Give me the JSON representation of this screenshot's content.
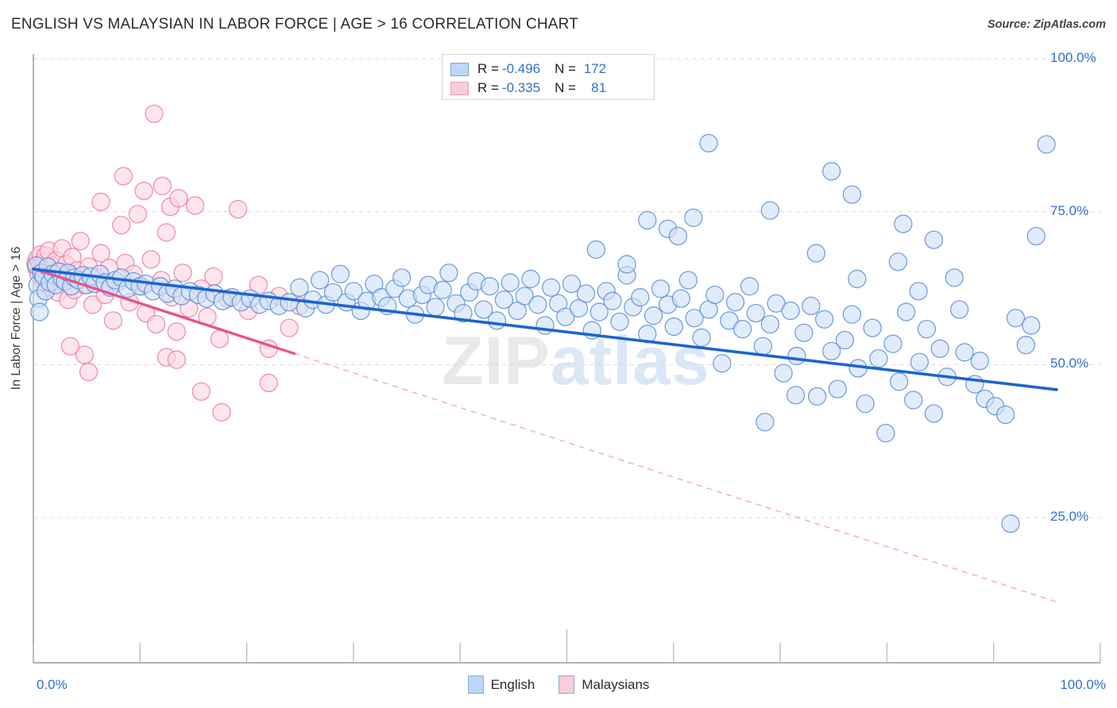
{
  "header": {
    "title": "ENGLISH VS MALAYSIAN IN LABOR FORCE | AGE > 16 CORRELATION CHART",
    "source": "Source: ZipAtlas.com"
  },
  "watermark": {
    "part1": "ZIP",
    "part2": "atlas"
  },
  "stats": {
    "rows": [
      {
        "series": "English",
        "r_label": "R = ",
        "r_value": "-0.496",
        "n_label": "N = ",
        "n_value": "172",
        "color": "#bdd7f7"
      },
      {
        "series": "Malaysians",
        "r_label": "R = ",
        "r_value": "-0.335",
        "n_label": "N = ",
        "n_value": "81",
        "color": "#fbccdb"
      }
    ]
  },
  "legend": {
    "items": [
      {
        "label": "English",
        "color": "#bdd7f7"
      },
      {
        "label": "Malaysians",
        "color": "#fbccdb"
      }
    ]
  },
  "axes": {
    "y_label": "In Labor Force | Age > 16",
    "y_ticks": [
      "100.0%",
      "75.0%",
      "50.0%",
      "25.0%"
    ],
    "x_ticks": [
      "0.0%",
      "100.0%"
    ]
  },
  "chart_data": {
    "type": "scatter",
    "title": "ENGLISH VS MALAYSIAN IN LABOR FORCE | AGE > 16 CORRELATION CHART",
    "xlabel": "",
    "ylabel": "In Labor Force | Age > 16",
    "xlim": [
      0,
      100
    ],
    "ylim": [
      0,
      103
    ],
    "x_tick_values": [
      0,
      100
    ],
    "y_tick_values": [
      25,
      50,
      75,
      100
    ],
    "grid": "horizontal-dashed",
    "legend_position": "bottom-center",
    "colors": {
      "english_fill": "#cfe0f7",
      "english_stroke": "#5a8fd6",
      "english_line": "#1c64d1",
      "malaysian_fill": "#fbd5e0",
      "malaysian_stroke": "#ee7ba5",
      "malaysian_line": "#e8538a",
      "tick_text": "#2f6fd0",
      "title_text": "#2b2b2b"
    },
    "series": [
      {
        "name": "English",
        "r": -0.496,
        "n": 172,
        "trend": {
          "x0": 0,
          "y0": 65.6,
          "x1": 100,
          "y1": 45.9,
          "style": "solid"
        },
        "points": [
          [
            0.3,
            66.2
          ],
          [
            0.4,
            63.0
          ],
          [
            0.5,
            60.8
          ],
          [
            0.6,
            58.6
          ],
          [
            0.8,
            65.0
          ],
          [
            1.0,
            64.4
          ],
          [
            1.2,
            62.0
          ],
          [
            1.4,
            66.0
          ],
          [
            1.6,
            63.4
          ],
          [
            1.9,
            64.8
          ],
          [
            2.2,
            63.0
          ],
          [
            2.5,
            65.2
          ],
          [
            2.8,
            64.0
          ],
          [
            3.1,
            63.6
          ],
          [
            3.4,
            65.0
          ],
          [
            3.7,
            62.8
          ],
          [
            4.0,
            64.2
          ],
          [
            4.4,
            63.8
          ],
          [
            4.8,
            64.6
          ],
          [
            5.2,
            63.0
          ],
          [
            5.6,
            64.4
          ],
          [
            6.0,
            63.2
          ],
          [
            6.5,
            64.8
          ],
          [
            7.0,
            63.4
          ],
          [
            7.5,
            62.6
          ],
          [
            8.0,
            63.8
          ],
          [
            8.6,
            64.2
          ],
          [
            9.2,
            62.4
          ],
          [
            9.8,
            63.6
          ],
          [
            10.4,
            62.8
          ],
          [
            11.0,
            63.2
          ],
          [
            11.7,
            62.0
          ],
          [
            12.4,
            62.8
          ],
          [
            13.1,
            61.6
          ],
          [
            13.8,
            62.4
          ],
          [
            14.5,
            61.2
          ],
          [
            15.3,
            62.0
          ],
          [
            16.1,
            61.4
          ],
          [
            16.9,
            60.8
          ],
          [
            17.7,
            61.6
          ],
          [
            18.5,
            60.4
          ],
          [
            19.4,
            61.0
          ],
          [
            20.3,
            60.2
          ],
          [
            21.2,
            60.8
          ],
          [
            22.1,
            59.8
          ],
          [
            23.0,
            60.4
          ],
          [
            24.0,
            59.6
          ],
          [
            25.0,
            60.2
          ],
          [
            26.0,
            62.6
          ],
          [
            26.6,
            59.2
          ],
          [
            27.3,
            60.6
          ],
          [
            28.0,
            63.8
          ],
          [
            28.6,
            59.8
          ],
          [
            29.3,
            61.8
          ],
          [
            30.0,
            64.8
          ],
          [
            30.6,
            60.2
          ],
          [
            31.3,
            62.0
          ],
          [
            32.0,
            58.8
          ],
          [
            32.6,
            60.4
          ],
          [
            33.3,
            63.2
          ],
          [
            34.0,
            61.0
          ],
          [
            34.6,
            59.6
          ],
          [
            35.3,
            62.4
          ],
          [
            36.0,
            64.2
          ],
          [
            36.6,
            60.8
          ],
          [
            37.3,
            58.2
          ],
          [
            38.0,
            61.4
          ],
          [
            38.6,
            63.0
          ],
          [
            39.3,
            59.4
          ],
          [
            40.0,
            62.2
          ],
          [
            40.6,
            65.0
          ],
          [
            41.3,
            60.0
          ],
          [
            42.0,
            58.4
          ],
          [
            42.6,
            61.8
          ],
          [
            43.3,
            63.6
          ],
          [
            44.0,
            59.0
          ],
          [
            44.6,
            62.8
          ],
          [
            45.3,
            57.2
          ],
          [
            46.0,
            60.6
          ],
          [
            46.6,
            63.4
          ],
          [
            47.3,
            58.8
          ],
          [
            48.0,
            61.2
          ],
          [
            48.6,
            64.0
          ],
          [
            49.3,
            59.8
          ],
          [
            50.0,
            56.4
          ],
          [
            50.6,
            62.6
          ],
          [
            51.3,
            60.0
          ],
          [
            52.0,
            57.8
          ],
          [
            52.6,
            63.2
          ],
          [
            53.3,
            59.2
          ],
          [
            54.0,
            61.6
          ],
          [
            54.6,
            55.6
          ],
          [
            55.3,
            58.6
          ],
          [
            56.0,
            62.0
          ],
          [
            56.6,
            60.4
          ],
          [
            57.3,
            57.0
          ],
          [
            58.0,
            64.6
          ],
          [
            58.6,
            59.4
          ],
          [
            59.3,
            61.0
          ],
          [
            60.0,
            55.0
          ],
          [
            60.6,
            58.0
          ],
          [
            61.3,
            62.4
          ],
          [
            62.0,
            59.8
          ],
          [
            62.6,
            56.2
          ],
          [
            63.3,
            60.8
          ],
          [
            64.0,
            63.8
          ],
          [
            64.6,
            57.6
          ],
          [
            65.3,
            54.4
          ],
          [
            66.0,
            59.0
          ],
          [
            66.6,
            61.4
          ],
          [
            67.3,
            50.2
          ],
          [
            68.0,
            57.2
          ],
          [
            68.6,
            60.2
          ],
          [
            69.3,
            55.8
          ],
          [
            70.0,
            62.8
          ],
          [
            70.6,
            58.4
          ],
          [
            71.3,
            53.0
          ],
          [
            72.0,
            56.6
          ],
          [
            72.6,
            60.0
          ],
          [
            73.3,
            48.6
          ],
          [
            74.0,
            58.8
          ],
          [
            74.6,
            51.4
          ],
          [
            75.3,
            55.2
          ],
          [
            76.0,
            59.6
          ],
          [
            76.6,
            44.8
          ],
          [
            77.3,
            57.4
          ],
          [
            78.0,
            52.2
          ],
          [
            78.6,
            46.0
          ],
          [
            79.3,
            54.0
          ],
          [
            80.0,
            58.2
          ],
          [
            80.6,
            49.4
          ],
          [
            81.3,
            43.6
          ],
          [
            82.0,
            56.0
          ],
          [
            82.6,
            51.0
          ],
          [
            83.3,
            38.8
          ],
          [
            84.0,
            53.4
          ],
          [
            84.6,
            47.2
          ],
          [
            85.3,
            58.6
          ],
          [
            86.0,
            44.2
          ],
          [
            86.6,
            50.4
          ],
          [
            87.3,
            55.8
          ],
          [
            88.0,
            42.0
          ],
          [
            88.6,
            52.6
          ],
          [
            89.3,
            48.0
          ],
          [
            66.0,
            86.2
          ],
          [
            72.0,
            75.2
          ],
          [
            78.0,
            81.6
          ],
          [
            80.0,
            77.8
          ],
          [
            85.0,
            73.0
          ],
          [
            88.0,
            70.4
          ],
          [
            60.0,
            73.6
          ],
          [
            62.0,
            72.2
          ],
          [
            63.0,
            71.0
          ],
          [
            64.5,
            74.0
          ],
          [
            55.0,
            68.8
          ],
          [
            58.0,
            66.4
          ],
          [
            90.0,
            64.2
          ],
          [
            91.0,
            52.0
          ],
          [
            92.0,
            46.8
          ],
          [
            93.0,
            44.4
          ],
          [
            94.0,
            43.2
          ],
          [
            95.0,
            41.8
          ],
          [
            96.0,
            57.6
          ],
          [
            97.0,
            53.2
          ],
          [
            98.0,
            71.0
          ],
          [
            99.0,
            86.0
          ],
          [
            95.5,
            24.0
          ],
          [
            97.5,
            56.4
          ],
          [
            90.5,
            59.0
          ],
          [
            92.5,
            50.6
          ],
          [
            86.5,
            62.0
          ],
          [
            84.5,
            66.8
          ],
          [
            80.5,
            64.0
          ],
          [
            76.5,
            68.2
          ],
          [
            74.5,
            45.0
          ],
          [
            71.5,
            40.6
          ]
        ]
      },
      {
        "name": "Malaysians",
        "r": -0.335,
        "n": 81,
        "trend": {
          "x0": 0,
          "y0": 65.7,
          "x1": 100,
          "y1": 11.2,
          "solid_until_x": 25.5,
          "style": "solid-then-dashed"
        },
        "points": [
          [
            0.2,
            66.6
          ],
          [
            0.3,
            65.8
          ],
          [
            0.4,
            67.4
          ],
          [
            0.5,
            64.8
          ],
          [
            0.6,
            66.0
          ],
          [
            0.7,
            68.0
          ],
          [
            0.8,
            65.2
          ],
          [
            0.9,
            63.8
          ],
          [
            1.0,
            66.8
          ],
          [
            1.1,
            64.4
          ],
          [
            1.2,
            67.8
          ],
          [
            1.3,
            62.6
          ],
          [
            1.4,
            65.6
          ],
          [
            1.5,
            68.6
          ],
          [
            1.6,
            64.0
          ],
          [
            1.8,
            66.2
          ],
          [
            2.0,
            63.2
          ],
          [
            2.2,
            67.0
          ],
          [
            2.4,
            61.8
          ],
          [
            2.6,
            65.0
          ],
          [
            2.8,
            69.0
          ],
          [
            3.0,
            63.6
          ],
          [
            3.2,
            66.4
          ],
          [
            3.4,
            60.6
          ],
          [
            3.6,
            64.6
          ],
          [
            3.8,
            67.6
          ],
          [
            4.0,
            62.2
          ],
          [
            4.3,
            65.4
          ],
          [
            4.6,
            70.2
          ],
          [
            5.0,
            63.0
          ],
          [
            5.4,
            66.0
          ],
          [
            5.8,
            59.8
          ],
          [
            6.2,
            64.2
          ],
          [
            6.6,
            68.2
          ],
          [
            7.0,
            61.4
          ],
          [
            7.4,
            65.8
          ],
          [
            7.8,
            57.2
          ],
          [
            8.2,
            63.4
          ],
          [
            8.6,
            72.8
          ],
          [
            9.0,
            66.6
          ],
          [
            9.4,
            60.2
          ],
          [
            9.8,
            64.8
          ],
          [
            10.2,
            74.6
          ],
          [
            10.6,
            62.8
          ],
          [
            11.0,
            58.4
          ],
          [
            11.5,
            67.2
          ],
          [
            12.0,
            56.6
          ],
          [
            12.5,
            63.8
          ],
          [
            13.0,
            71.6
          ],
          [
            13.5,
            61.0
          ],
          [
            14.0,
            55.4
          ],
          [
            14.6,
            65.0
          ],
          [
            15.2,
            59.2
          ],
          [
            15.8,
            76.0
          ],
          [
            16.4,
            62.4
          ],
          [
            17.0,
            57.8
          ],
          [
            17.6,
            64.4
          ],
          [
            18.2,
            54.2
          ],
          [
            19.0,
            60.8
          ],
          [
            20.0,
            75.4
          ],
          [
            21.0,
            58.8
          ],
          [
            22.0,
            63.0
          ],
          [
            23.0,
            52.6
          ],
          [
            24.0,
            61.2
          ],
          [
            25.0,
            56.0
          ],
          [
            26.0,
            59.6
          ],
          [
            11.8,
            91.0
          ],
          [
            8.8,
            80.8
          ],
          [
            10.8,
            78.4
          ],
          [
            12.6,
            79.2
          ],
          [
            6.6,
            76.6
          ],
          [
            13.4,
            75.8
          ],
          [
            14.2,
            77.2
          ],
          [
            13.0,
            51.2
          ],
          [
            14.0,
            50.8
          ],
          [
            16.4,
            45.6
          ],
          [
            18.4,
            42.2
          ],
          [
            23.0,
            47.0
          ],
          [
            5.0,
            51.6
          ],
          [
            5.4,
            48.8
          ],
          [
            3.6,
            53.0
          ]
        ]
      }
    ]
  }
}
